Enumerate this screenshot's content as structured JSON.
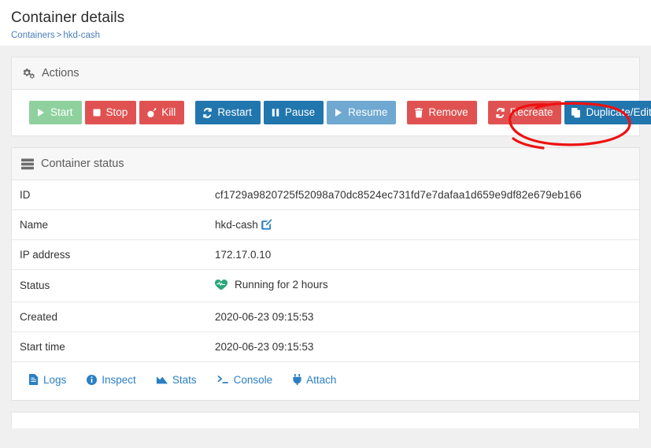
{
  "page": {
    "title": "Container details",
    "breadcrumb": {
      "root": "Containers",
      "separator": ">",
      "current": "hkd-cash"
    }
  },
  "actions_card": {
    "header": "Actions",
    "header_icon": "gears-icon",
    "buttons": [
      {
        "label": "Start",
        "icon": "play-icon",
        "color": "#8fd19e",
        "state": "disabled"
      },
      {
        "label": "Stop",
        "icon": "stop-icon",
        "color": "#e05252",
        "state": "enabled"
      },
      {
        "label": "Kill",
        "icon": "bomb-icon",
        "color": "#e05252",
        "state": "enabled"
      },
      {
        "label": "Restart",
        "icon": "sync-icon",
        "color": "#2176ae",
        "state": "enabled"
      },
      {
        "label": "Pause",
        "icon": "pause-icon",
        "color": "#2176ae",
        "state": "enabled"
      },
      {
        "label": "Resume",
        "icon": "play-icon",
        "color": "#6fa8d0",
        "state": "disabled"
      },
      {
        "label": "Remove",
        "icon": "trash-icon",
        "color": "#e05252",
        "state": "enabled"
      },
      {
        "label": "Recreate",
        "icon": "sync-icon",
        "color": "#e05252",
        "state": "enabled"
      },
      {
        "label": "Duplicate/Edit",
        "icon": "copy-icon",
        "color": "#2176ae",
        "state": "enabled"
      }
    ]
  },
  "status_card": {
    "header": "Container status",
    "header_icon": "server-icon",
    "rows": [
      {
        "label": "ID",
        "value": "cf1729a9820725f52098a70dc8524ec731fd7e7dafaa1d659e9df82e679eb166"
      },
      {
        "label": "Name",
        "value": "hkd-cash",
        "edit_icon": "pencil-square-icon"
      },
      {
        "label": "IP address",
        "value": "172.17.0.10"
      },
      {
        "label": "Status",
        "value": "Running for 2 hours",
        "icon": "heartbeat-icon",
        "icon_color": "#28a77a"
      },
      {
        "label": "Created",
        "value": "2020-06-23 09:15:53"
      },
      {
        "label": "Start time",
        "value": "2020-06-23 09:15:53"
      }
    ],
    "links": [
      {
        "label": "Logs",
        "icon": "file-icon"
      },
      {
        "label": "Inspect",
        "icon": "info-circle-icon"
      },
      {
        "label": "Stats",
        "icon": "chart-area-icon"
      },
      {
        "label": "Console",
        "icon": "terminal-icon"
      },
      {
        "label": "Attach",
        "icon": "plug-icon"
      }
    ]
  },
  "annotation": {
    "shape": "hand-drawn-ellipse",
    "color": "#ee1111",
    "target": "Duplicate/Edit"
  },
  "colors": {
    "page_bg": "#f0f0f0",
    "card_bg": "#ffffff",
    "card_header_bg": "#f7f7f7",
    "link": "#2a7fc4",
    "breadcrumb": "#4a7fbd"
  }
}
